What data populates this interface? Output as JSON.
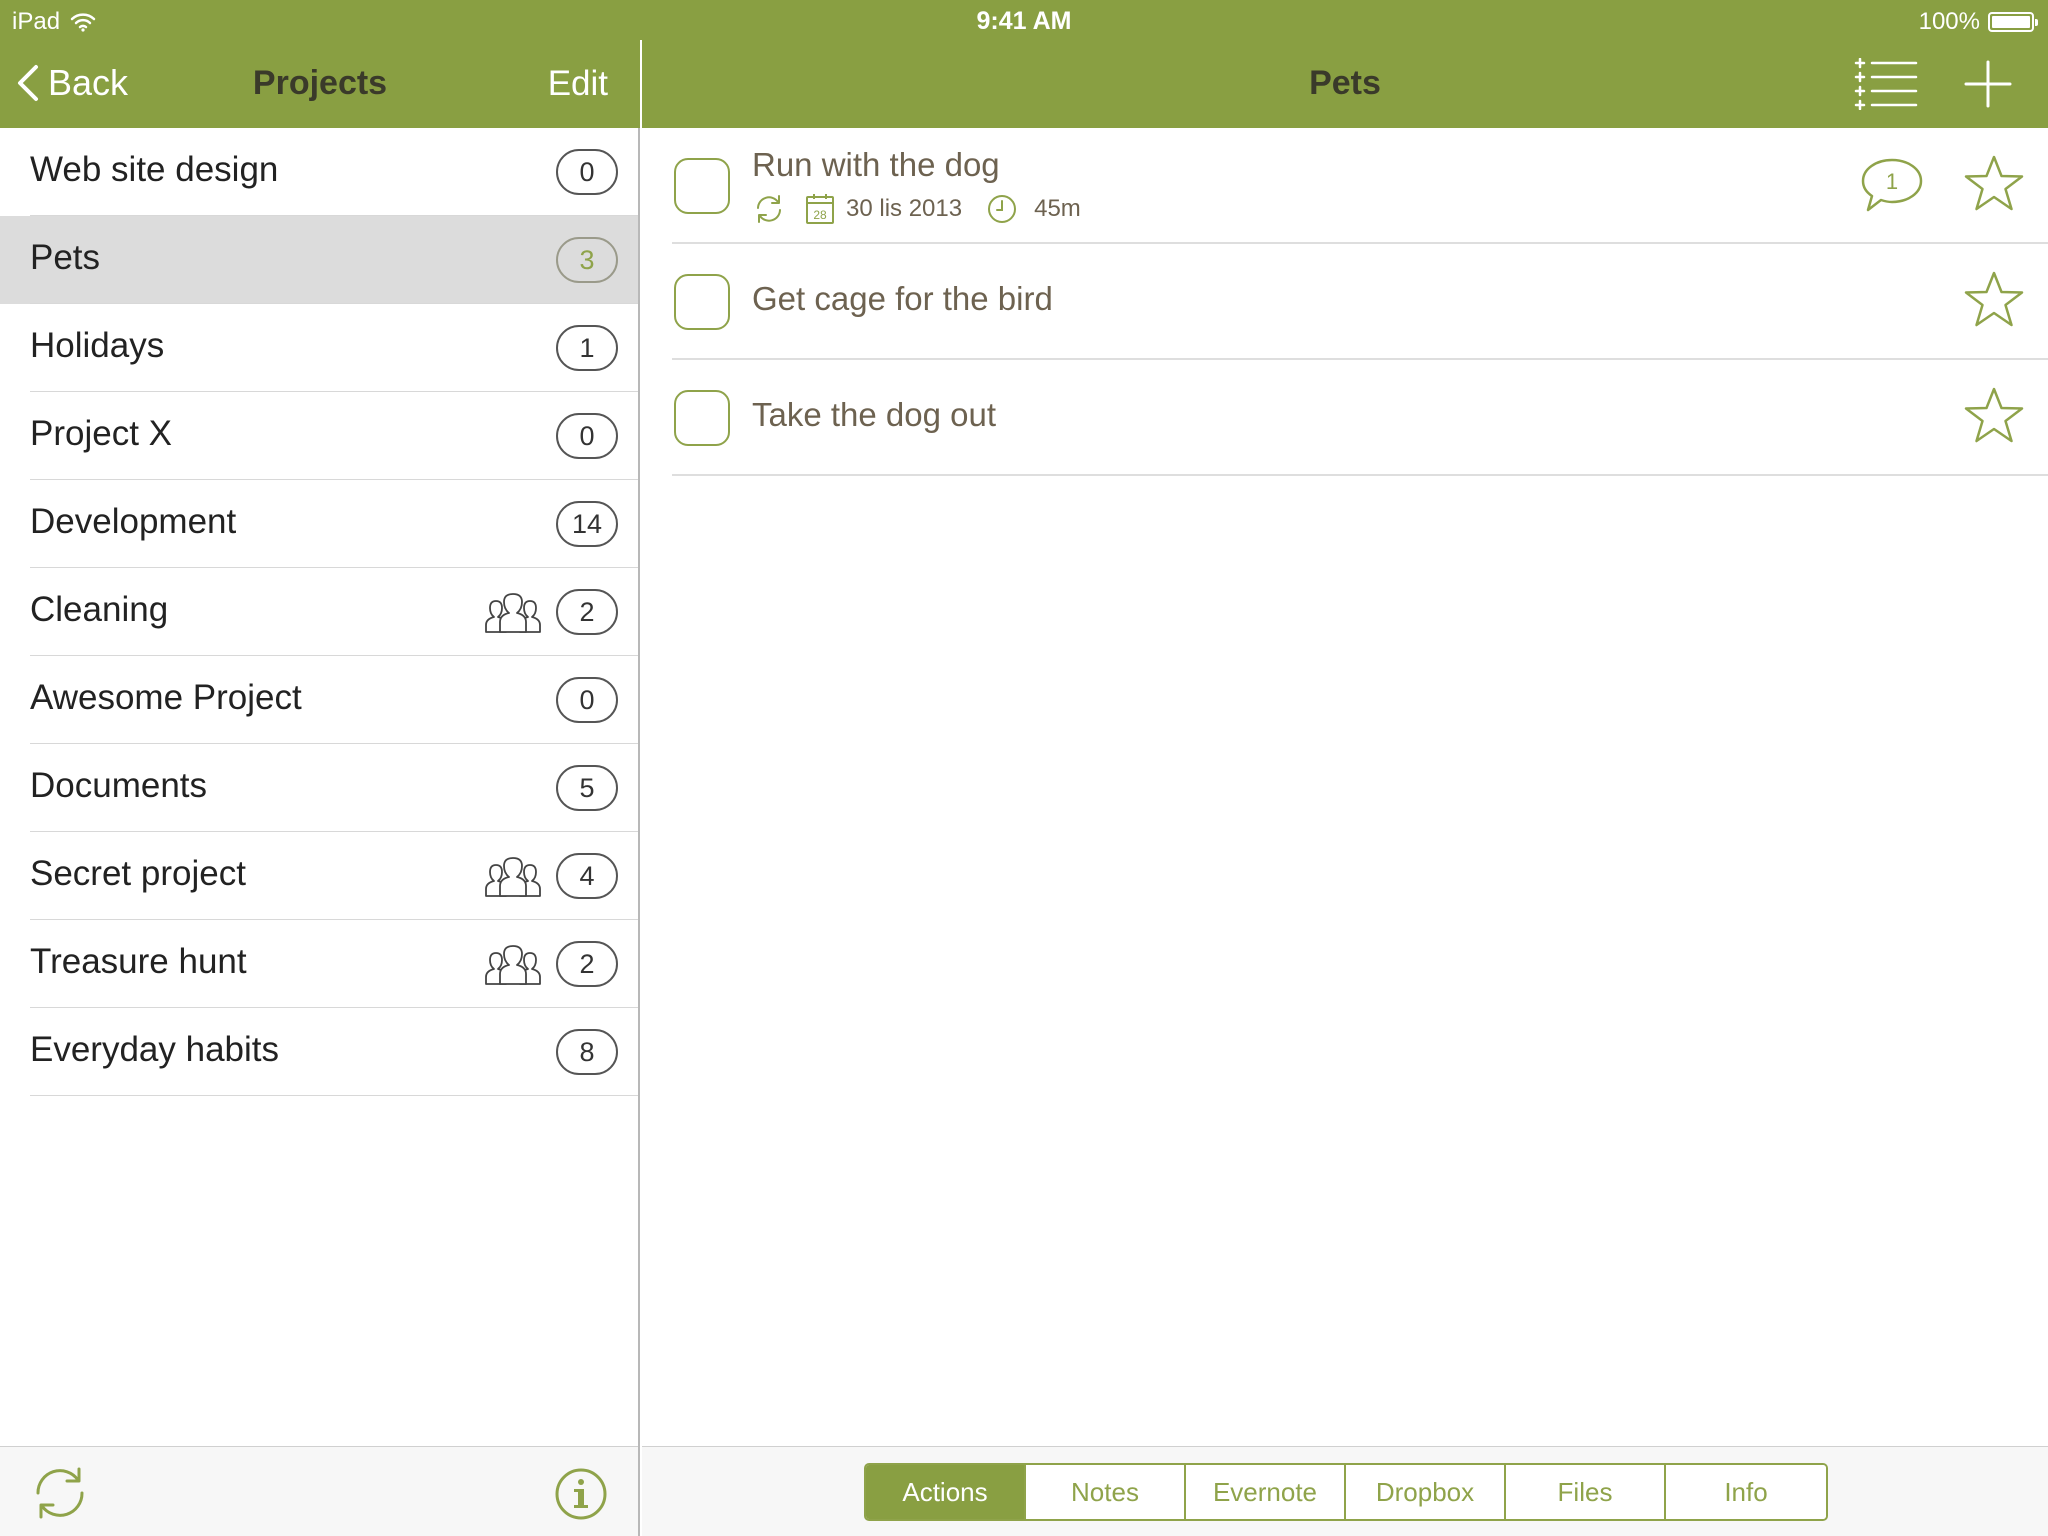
{
  "status_bar": {
    "device": "iPad",
    "time": "9:41 AM",
    "battery": "100%"
  },
  "left_panel": {
    "back_label": "Back",
    "title": "Projects",
    "edit_label": "Edit",
    "projects": [
      {
        "name": "Web site design",
        "count": "0",
        "shared": false,
        "selected": false
      },
      {
        "name": "Pets",
        "count": "3",
        "shared": false,
        "selected": true
      },
      {
        "name": "Holidays",
        "count": "1",
        "shared": false,
        "selected": false
      },
      {
        "name": "Project X",
        "count": "0",
        "shared": false,
        "selected": false
      },
      {
        "name": "Development",
        "count": "14",
        "shared": false,
        "selected": false
      },
      {
        "name": "Cleaning",
        "count": "2",
        "shared": true,
        "selected": false
      },
      {
        "name": "Awesome Project",
        "count": "0",
        "shared": false,
        "selected": false
      },
      {
        "name": "Documents",
        "count": "5",
        "shared": false,
        "selected": false
      },
      {
        "name": "Secret project",
        "count": "4",
        "shared": true,
        "selected": false
      },
      {
        "name": "Treasure hunt",
        "count": "2",
        "shared": true,
        "selected": false
      },
      {
        "name": "Everyday habits",
        "count": "8",
        "shared": false,
        "selected": false
      }
    ]
  },
  "right_panel": {
    "title": "Pets",
    "tasks": [
      {
        "title": "Run with the dog",
        "repeat": true,
        "calendar_day": "28",
        "date": "30 lis 2013",
        "duration": "45m",
        "comments": "1",
        "starred": false
      },
      {
        "title": "Get cage for the bird",
        "starred": false
      },
      {
        "title": "Take the dog out",
        "starred": false
      }
    ],
    "tabs": [
      {
        "label": "Actions",
        "active": true
      },
      {
        "label": "Notes",
        "active": false
      },
      {
        "label": "Evernote",
        "active": false
      },
      {
        "label": "Dropbox",
        "active": false
      },
      {
        "label": "Files",
        "active": false
      },
      {
        "label": "Info",
        "active": false
      }
    ]
  },
  "colors": {
    "accent": "#899f42",
    "accent_light": "#8fa34a",
    "task_text": "#6d6250",
    "selected_row": "#dcdcdc"
  },
  "icons": {
    "wifi": "wifi-icon",
    "back": "chevron-left-icon",
    "shared": "people-group-icon",
    "sync": "sync-icon",
    "info": "info-icon",
    "list": "list-icon",
    "add": "plus-icon",
    "repeat": "repeat-icon",
    "calendar": "calendar-icon",
    "clock": "clock-icon",
    "comment": "comment-icon",
    "star": "star-icon"
  }
}
